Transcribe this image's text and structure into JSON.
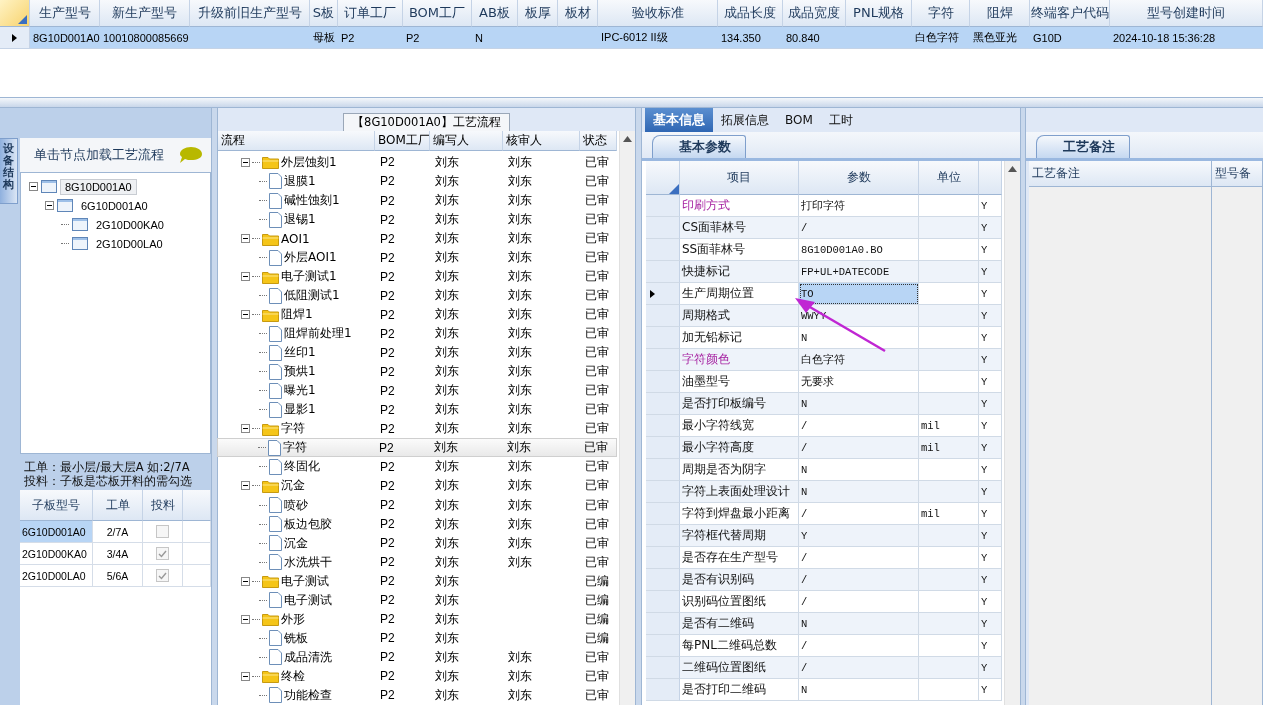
{
  "top_grid": {
    "columns": [
      "生产型号",
      "新生产型号",
      "升级前旧生产型号",
      "S板",
      "订单工厂",
      "BOM工厂",
      "AB板",
      "板厚",
      "板材",
      "验收标准",
      "成品长度",
      "成品宽度",
      "PNL规格",
      "字符",
      "阻焊",
      "终端客户代码",
      "型号创建时间"
    ],
    "rows": [
      {
        "selected": true,
        "cells": [
          "8G10D001A0",
          "10010800085669",
          null,
          "母板",
          "P2",
          "P2",
          "N",
          null,
          null,
          "IPC-6012 II级",
          "134.350",
          "80.840",
          null,
          "白色字符",
          "黑色亚光",
          "G10D",
          "2024-10-18 15:36:28"
        ]
      }
    ]
  },
  "left_panel": {
    "side_tab": "设备结构",
    "header": "单击节点加载工艺流程",
    "tree": [
      {
        "label": "8G10D001A0",
        "selected": true,
        "expanded": true,
        "children": [
          {
            "label": "6G10D001A0",
            "selected": false,
            "expanded": true,
            "children": [
              {
                "label": "2G10D00KA0",
                "selected": false
              },
              {
                "label": "2G10D00LA0",
                "selected": false
              }
            ]
          }
        ]
      }
    ],
    "notes": [
      "工单：最小层/最大层A 如:2/7A",
      "投料：子板是芯板开料的需勾选"
    ],
    "sub_boards": {
      "columns": [
        "子板型号",
        "工单",
        "投料"
      ],
      "rows": [
        {
          "model": "6G10D001A0",
          "order": "2/7A",
          "feed": false,
          "selected": true
        },
        {
          "model": "2G10D00KA0",
          "order": "3/4A",
          "feed": true,
          "selected": false
        },
        {
          "model": "2G10D00LA0",
          "order": "5/6A",
          "feed": true,
          "selected": false
        }
      ]
    }
  },
  "process_panel": {
    "title": "【8G10D001A0】工艺流程",
    "columns": [
      "流程",
      "BOM工厂",
      "编写人",
      "核审人",
      "状态"
    ],
    "tree": [
      {
        "label": "外层蚀刻1",
        "bom": "P2",
        "writer": "刘东",
        "reviewer": "刘东",
        "status": "已审",
        "selected": false,
        "expanded": true,
        "children": [
          {
            "label": "退膜1",
            "bom": "P2",
            "writer": "刘东",
            "reviewer": "刘东",
            "status": "已审",
            "selected": false
          },
          {
            "label": "碱性蚀刻1",
            "bom": "P2",
            "writer": "刘东",
            "reviewer": "刘东",
            "status": "已审",
            "selected": false
          },
          {
            "label": "退锡1",
            "bom": "P2",
            "writer": "刘东",
            "reviewer": "刘东",
            "status": "已审",
            "selected": false
          }
        ]
      },
      {
        "label": "AOI1",
        "bom": "P2",
        "writer": "刘东",
        "reviewer": "刘东",
        "status": "已审",
        "selected": false,
        "expanded": true,
        "children": [
          {
            "label": "外层AOI1",
            "bom": "P2",
            "writer": "刘东",
            "reviewer": "刘东",
            "status": "已审",
            "selected": false
          }
        ]
      },
      {
        "label": "电子测试1",
        "bom": "P2",
        "writer": "刘东",
        "reviewer": "刘东",
        "status": "已审",
        "selected": false,
        "expanded": true,
        "children": [
          {
            "label": "低阻测试1",
            "bom": "P2",
            "writer": "刘东",
            "reviewer": "刘东",
            "status": "已审",
            "selected": false
          }
        ]
      },
      {
        "label": "阻焊1",
        "bom": "P2",
        "writer": "刘东",
        "reviewer": "刘东",
        "status": "已审",
        "selected": false,
        "expanded": true,
        "children": [
          {
            "label": "阻焊前处理1",
            "bom": "P2",
            "writer": "刘东",
            "reviewer": "刘东",
            "status": "已审",
            "selected": false
          },
          {
            "label": "丝印1",
            "bom": "P2",
            "writer": "刘东",
            "reviewer": "刘东",
            "status": "已审",
            "selected": false
          },
          {
            "label": "预烘1",
            "bom": "P2",
            "writer": "刘东",
            "reviewer": "刘东",
            "status": "已审",
            "selected": false
          },
          {
            "label": "曝光1",
            "bom": "P2",
            "writer": "刘东",
            "reviewer": "刘东",
            "status": "已审",
            "selected": false
          },
          {
            "label": "显影1",
            "bom": "P2",
            "writer": "刘东",
            "reviewer": "刘东",
            "status": "已审",
            "selected": false
          }
        ]
      },
      {
        "label": "字符",
        "bom": "P2",
        "writer": "刘东",
        "reviewer": "刘东",
        "status": "已审",
        "selected": false,
        "expanded": true,
        "children": [
          {
            "label": "字符",
            "bom": "P2",
            "writer": "刘东",
            "reviewer": "刘东",
            "status": "已审",
            "selected": true
          },
          {
            "label": "终固化",
            "bom": "P2",
            "writer": "刘东",
            "reviewer": "刘东",
            "status": "已审",
            "selected": false
          }
        ]
      },
      {
        "label": "沉金",
        "bom": "P2",
        "writer": "刘东",
        "reviewer": "刘东",
        "status": "已审",
        "selected": false,
        "expanded": true,
        "children": [
          {
            "label": "喷砂",
            "bom": "P2",
            "writer": "刘东",
            "reviewer": "刘东",
            "status": "已审",
            "selected": false
          },
          {
            "label": "板边包胶",
            "bom": "P2",
            "writer": "刘东",
            "reviewer": "刘东",
            "status": "已审",
            "selected": false
          },
          {
            "label": "沉金",
            "bom": "P2",
            "writer": "刘东",
            "reviewer": "刘东",
            "status": "已审",
            "selected": false
          },
          {
            "label": "水洗烘干",
            "bom": "P2",
            "writer": "刘东",
            "reviewer": "刘东",
            "status": "已审",
            "selected": false
          }
        ]
      },
      {
        "label": "电子测试",
        "bom": "P2",
        "writer": "刘东",
        "status": "已编",
        "selected": false,
        "expanded": true,
        "children": [
          {
            "label": "电子测试",
            "bom": "P2",
            "writer": "刘东",
            "status": "已编",
            "selected": false
          }
        ]
      },
      {
        "label": "外形",
        "bom": "P2",
        "writer": "刘东",
        "status": "已编",
        "selected": false,
        "expanded": true,
        "children": [
          {
            "label": "铣板",
            "bom": "P2",
            "writer": "刘东",
            "status": "已编",
            "selected": false
          },
          {
            "label": "成品清洗",
            "bom": "P2",
            "writer": "刘东",
            "reviewer": "刘东",
            "status": "已审",
            "selected": false
          }
        ]
      },
      {
        "label": "终检",
        "bom": "P2",
        "writer": "刘东",
        "reviewer": "刘东",
        "status": "已审",
        "selected": false,
        "expanded": true,
        "children": [
          {
            "label": "功能检查",
            "bom": "P2",
            "writer": "刘东",
            "reviewer": "刘东",
            "status": "已审",
            "selected": false
          }
        ]
      }
    ]
  },
  "info_panel": {
    "tabs": [
      {
        "label": "基本信息",
        "selected": true
      },
      {
        "label": "拓展信息",
        "selected": false
      },
      {
        "label": "BOM",
        "selected": false
      },
      {
        "label": "工时",
        "selected": false
      }
    ],
    "subtab": "基本参数",
    "columns": [
      "项目",
      "参数",
      "单位"
    ],
    "rows": [
      {
        "item": "印刷方式",
        "value": "打印字符",
        "flag": "Y",
        "highlighted": true,
        "selected": false
      },
      {
        "item": "CS面菲林号",
        "value": "/",
        "flag": "Y",
        "highlighted": false,
        "selected": false
      },
      {
        "item": "SS面菲林号",
        "value": "8G10D001A0.BO",
        "flag": "Y",
        "highlighted": false,
        "selected": false
      },
      {
        "item": "快捷标记",
        "value": "FP+UL+DATECODE",
        "flag": "Y",
        "highlighted": false,
        "selected": false
      },
      {
        "item": "生产周期位置",
        "value": "TO",
        "flag": "Y",
        "highlighted": false,
        "selected": true
      },
      {
        "item": "周期格式",
        "value": "WWYY",
        "flag": "Y",
        "highlighted": false,
        "selected": false
      },
      {
        "item": "加无铅标记",
        "value": "N",
        "flag": "Y",
        "highlighted": false,
        "selected": false
      },
      {
        "item": "字符颜色",
        "value": "白色字符",
        "flag": "Y",
        "highlighted": true,
        "selected": false
      },
      {
        "item": "油墨型号",
        "value": "无要求",
        "flag": "Y",
        "highlighted": false,
        "selected": false
      },
      {
        "item": "是否打印板编号",
        "value": "N",
        "flag": "Y",
        "highlighted": false,
        "selected": false
      },
      {
        "item": "最小字符线宽",
        "value": "/",
        "unit": "mil",
        "flag": "Y",
        "highlighted": false,
        "selected": false
      },
      {
        "item": "最小字符高度",
        "value": "/",
        "unit": "mil",
        "flag": "Y",
        "highlighted": false,
        "selected": false
      },
      {
        "item": "周期是否为阴字",
        "value": "N",
        "flag": "Y",
        "highlighted": false,
        "selected": false
      },
      {
        "item": "字符上表面处理设计",
        "value": "N",
        "flag": "Y",
        "highlighted": false,
        "selected": false
      },
      {
        "item": "字符到焊盘最小距离",
        "value": "/",
        "unit": "mil",
        "flag": "Y",
        "highlighted": false,
        "selected": false
      },
      {
        "item": "字符框代替周期",
        "value": "Y",
        "flag": "Y",
        "highlighted": false,
        "selected": false
      },
      {
        "item": "是否存在生产型号",
        "value": "/",
        "flag": "Y",
        "highlighted": false,
        "selected": false
      },
      {
        "item": "是否有识别码",
        "value": "/",
        "flag": "Y",
        "highlighted": false,
        "selected": false
      },
      {
        "item": "识别码位置图纸",
        "value": "/",
        "flag": "Y",
        "highlighted": false,
        "selected": false
      },
      {
        "item": "是否有二维码",
        "value": "N",
        "flag": "Y",
        "highlighted": false,
        "selected": false
      },
      {
        "item": "每PNL二维码总数",
        "value": "/",
        "flag": "Y",
        "highlighted": false,
        "selected": false
      },
      {
        "item": "二维码位置图纸",
        "value": "/",
        "flag": "Y",
        "highlighted": false,
        "selected": false
      },
      {
        "item": "是否打印二维码",
        "value": "N",
        "flag": "Y",
        "highlighted": false,
        "selected": false
      }
    ]
  },
  "notes_panel": {
    "tab": "工艺备注",
    "columns": [
      "工艺备注",
      "型号备"
    ]
  }
}
